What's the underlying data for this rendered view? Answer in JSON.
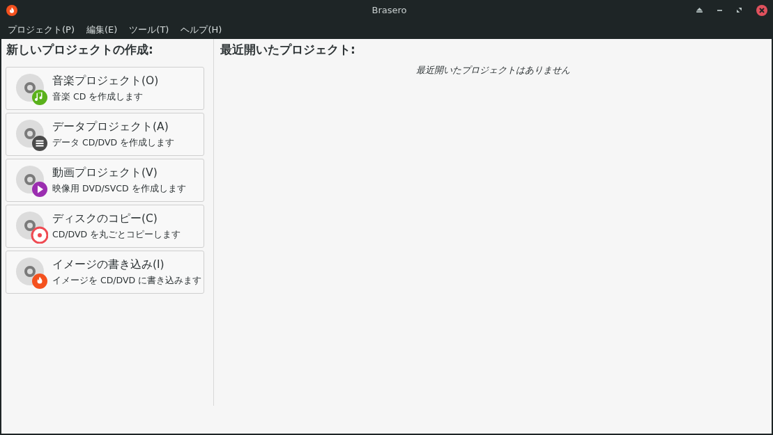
{
  "window": {
    "title": "Brasero"
  },
  "menu": [
    "プロジェクト(P)",
    "編集(E)",
    "ツール(T)",
    "ヘルプ(H)"
  ],
  "new_project": {
    "heading": "新しいプロジェクトの作成:",
    "items": [
      {
        "kind": "music",
        "title": "音楽プロジェクト(O)",
        "description": "音楽 CD を作成します"
      },
      {
        "kind": "data",
        "title": "データプロジェクト(A)",
        "description": "データ CD/DVD を作成します"
      },
      {
        "kind": "video",
        "title": "動画プロジェクト(V)",
        "description": "映像用 DVD/SVCD を作成します"
      },
      {
        "kind": "copy",
        "title": "ディスクのコピー(C)",
        "description": "CD/DVD を丸ごとコピーします"
      },
      {
        "kind": "image",
        "title": "イメージの書き込み(I)",
        "description": "イメージを CD/DVD に書き込みます"
      }
    ]
  },
  "recent": {
    "heading": "最近開いたプロジェクト:",
    "empty_message": "最近開いたプロジェクトはありません"
  }
}
